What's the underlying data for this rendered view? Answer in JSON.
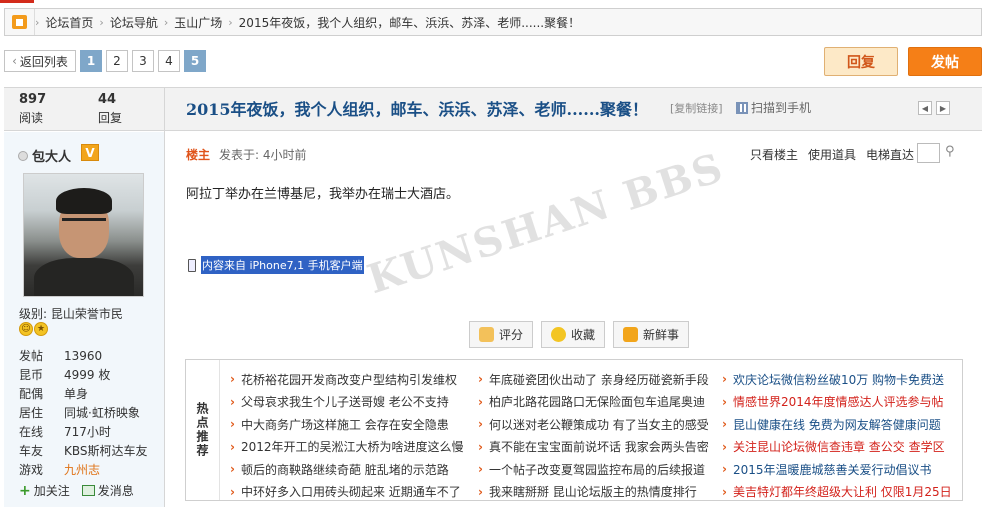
{
  "breadcrumbs": [
    "论坛首页",
    "论坛导航",
    "玉山广场",
    "2015年夜饭，我个人组织，邮车、浜浜、苏泽、老师......聚餐！"
  ],
  "pager": {
    "back": "返回列表",
    "pages": [
      "1",
      "2",
      "3",
      "4",
      "5"
    ],
    "current": "1",
    "last_highlight": "5"
  },
  "actions": {
    "reply": "回复",
    "post": "发帖"
  },
  "stats": {
    "views": "897",
    "views_label": "阅读",
    "replies": "44",
    "replies_label": "回复"
  },
  "thread": {
    "title": "2015年夜饭，我个人组织，邮车、浜浜、苏泽、老师......聚餐！",
    "copy_link": "[复制链接]",
    "scan": "扫描到手机"
  },
  "user": {
    "name": "包大人",
    "badge": "V",
    "level": "级别: 昆山荣誉市民",
    "info": [
      {
        "k": "发帖",
        "v": "13960"
      },
      {
        "k": "昆币",
        "v": "4999 枚"
      },
      {
        "k": "配偶",
        "v": "单身"
      },
      {
        "k": "居住",
        "v": "同城·虹桥映象"
      },
      {
        "k": "在线",
        "v": "717小时"
      },
      {
        "k": "车友",
        "v": "KBS斯柯达车友"
      },
      {
        "k": "游戏",
        "v": "九州志"
      }
    ],
    "follow": "加关注",
    "message": "发消息"
  },
  "post": {
    "louzhu": "楼主",
    "posted": "发表于: 4小时前",
    "content": "阿拉丁举办在兰博基尼，我举办在瑞士大酒店。",
    "client": "内容来自 iPhone7,1 手机客户端",
    "tools": [
      "只看楼主",
      "使用道具",
      "电梯直达"
    ]
  },
  "buttons": {
    "rate": "评分",
    "favorite": "收藏",
    "fresh": "新鲜事"
  },
  "hot": {
    "label": "热点推荐",
    "col1": [
      "花桥裕花园开发商改变户型结构引发维权",
      "父母哀求我生个儿子送哥嫂 老公不支持",
      "中大商务广场这样施工 会存在安全隐患",
      "2012年开工的吴淞江大桥为啥进度这么慢",
      "顿后的商鞅路继续奇葩 脏乱堵的示范路",
      "中环好多入口用砖头砌起来 近期通车不了"
    ],
    "col2": [
      "年底碰瓷团伙出动了 亲身经历碰瓷新手段",
      "柏庐北路花园路口无保险面包车追尾奥迪",
      "何以迷对老公鞭策成功 有了当女主的感受",
      "真不能在宝宝面前说坏话 我家会两头告密",
      "一个帖子改变夏驾园监控布局的后续报道",
      "我来瞎掰掰 昆山论坛版主的热情度排行"
    ],
    "col3": [
      "欢庆论坛微信粉丝破10万 购物卡免费送",
      "情感世界2014年度情感达人评选参与帖",
      "昆山健康在线 免费为网友解答健康问题",
      "关注昆山论坛微信查违章 查公交 查学区",
      "2015年温暖鹿城慈善关爱行动倡议书",
      "美吉特灯都年终超级大让利 仅限1月25日"
    ]
  },
  "colors": {
    "accent": "#f57f17",
    "link_blue": "#1a4f86",
    "hot_red": "#d3221b"
  }
}
